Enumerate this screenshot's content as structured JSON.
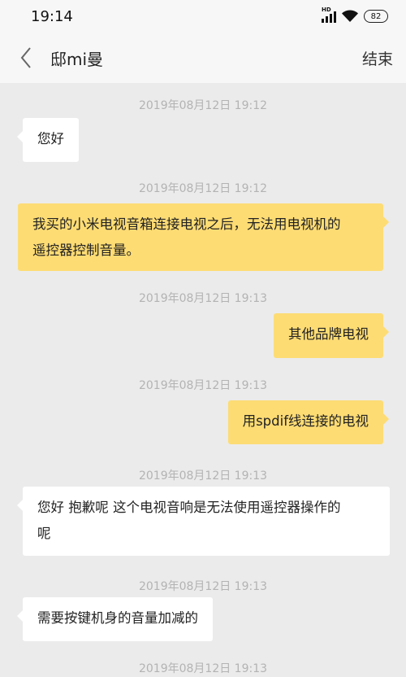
{
  "status_bar": {
    "time": "19:14",
    "signal_label": "HD",
    "battery": "82"
  },
  "nav": {
    "title": "邸mi曼",
    "end_label": "结束"
  },
  "messages": [
    {
      "timestamp": "2019年08月12日 19:12",
      "side": "in",
      "text": "您好"
    },
    {
      "timestamp": "2019年08月12日 19:12",
      "side": "out",
      "line1": "我买的小米电视音箱连接电视之后，无法用电视机的",
      "line2": "遥控器控制音量。"
    },
    {
      "timestamp": "2019年08月12日 19:13",
      "side": "out",
      "text": "其他品牌电视"
    },
    {
      "timestamp": "2019年08月12日 19:13",
      "side": "out",
      "text": "用spdif线连接的电视"
    },
    {
      "timestamp": "2019年08月12日 19:13",
      "side": "in",
      "line1": "您好 抱歉呢 这个电视音响是无法使用遥控器操作的",
      "line2": "呢"
    },
    {
      "timestamp": "2019年08月12日 19:13",
      "side": "in",
      "text": "需要按键机身的音量加减的"
    },
    {
      "timestamp": "2019年08月12日 19:13"
    }
  ]
}
